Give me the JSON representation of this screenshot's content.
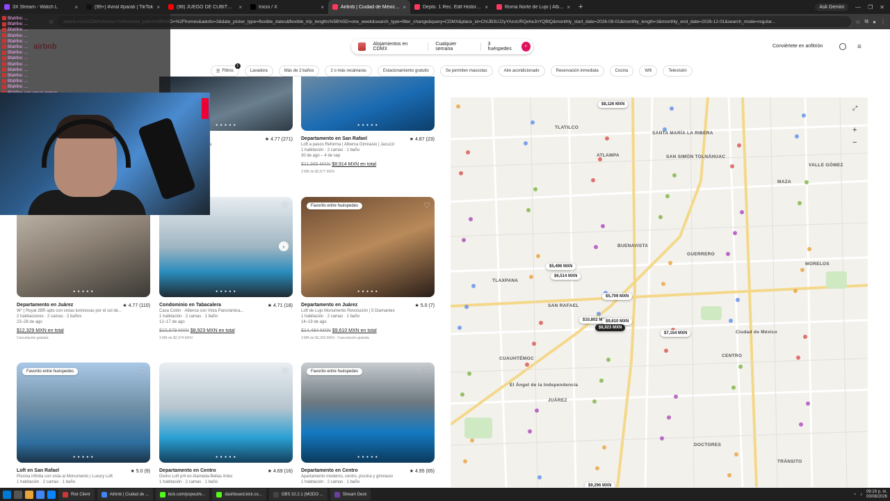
{
  "browser": {
    "tabs": [
      {
        "label": "3X Stream - Watch L",
        "color": "#9146ff"
      },
      {
        "label": "(99+) #viral #parati | TikTok",
        "color": "#111111"
      },
      {
        "label": "(98) JUEGO DE CUBITOS + RE",
        "color": "#ff0000"
      },
      {
        "label": "Inicio / X",
        "color": "#000000"
      },
      {
        "label": "Airbnb | Ciudad de México - Al",
        "color": "#ff385c",
        "active": true
      },
      {
        "label": "Depto. 1 Rec. Edif Histórico Sa",
        "color": "#ff385c"
      },
      {
        "label": "Roma Norte de Lujo | Alberca,",
        "color": "#ff385c"
      }
    ],
    "new_tab": "+",
    "ask_gemini": "Ask Gemini",
    "url": "airbnb.mx/s/CDMX/homes?refinement_paths%5B%5D=%2Fhomes&adults=3&date_picker_type=flexible_dates&flexible_trip_lengths%5B%5D=one_week&search_type=filter_change&query=CDMX&place_id=ChIJB3UJ2yYAzoURQeheJnYQBlQ&monthly_start_date=2026-09-01&monthly_length=3&monthly_end_date=2026-12-01&search_mode=regular..."
  },
  "chat": {
    "lines": [
      "Bfahfire: ...",
      "Bfahfire: ...",
      "Bfahfire: ...",
      "Bfahfire: ...",
      "Bfahfire: ...",
      "Bfahfire: ...",
      "Bfahfire: ...",
      "Bfahfire: ...",
      "Bfahfire: ...",
      "Bfahfire: ...",
      "Bfahfire: ...",
      "Bfahfire: ...",
      "Bfahfire: ...",
      "Bfahfire: sen aguas negras"
    ]
  },
  "header": {
    "logo": "airbnb",
    "search": {
      "location": "Alojamientos en CDMX",
      "dates": "Cualquier semana",
      "guests": "3 huéspedes"
    },
    "host_link": "Conviértete en anfitrión"
  },
  "filters": {
    "main": "Filtros",
    "badge": "1",
    "chips": [
      "Lavadora",
      "Más de 2 baños",
      "2 o más recámaras",
      "Estacionamiento gratuito",
      "Se permiten mascotas",
      "Aire acondicionado",
      "Reservación inmediata",
      "Cocina",
      "Wifi",
      "Televisión"
    ]
  },
  "listings": [
    {
      "title": "...uárez",
      "rating": "★ 4.77 (271)",
      "desc1": "...rvlala de Reforma, alberca",
      "desc2": "1 baño",
      "desc3": "",
      "old_price": "",
      "price": "...XN en total",
      "sub": "...cepada",
      "fav": false
    },
    {
      "title": "Departamento en San Rafael",
      "rating": "★ 4.87 (23)",
      "desc1": "Loft a pasos Reforma | Alberca Gimnasio | Jacuzzi",
      "desc2": "1 habitación · 2 camas · 1 baño",
      "desc3": "30 de ago – 4 de sep",
      "old_price": "$11,565 MXN",
      "price": "$8,914 MXN en total",
      "sub": "3 MB de $2,577 MXN",
      "fav": false
    },
    {
      "title": "Departamento en Juárez",
      "rating": "★ 4.77 (110)",
      "desc1": "W° | Royal 2BR apts con vistas luminosas por el sol de...",
      "desc2": "2 habitaciones · 2 camas · 2 baños",
      "desc3": "23–28 de ago",
      "old_price": "",
      "price": "$12,329 MXN en total",
      "sub": "Cancelación gratuita",
      "fav": false
    },
    {
      "title": "Condominio en Tabacalera",
      "rating": "★ 4.71 (18)",
      "desc1": "Casa Colón · Alberca con Vista Panorámica...",
      "desc2": "1 habitación · 2 camas · 1 baño",
      "desc3": "12–17 de ago",
      "old_price": "$10,679 MXN",
      "price": "$8,923 MXN en total",
      "sub": "3 MB de $2,974 MXN",
      "fav": false
    },
    {
      "title": "Departamento en Juárez",
      "rating": "★ 5.0 (7)",
      "desc1": "Loft de Lujo Monumento Revolución | 5 Diamantes",
      "desc2": "1 habitación · 2 camas · 1 baño",
      "desc3": "14–19 de ago",
      "old_price": "$14,494 MXN",
      "price": "$9,610 MXN en total",
      "sub": "3 MB de $3,203 MXN · Cancelación gratuita",
      "fav": true
    },
    {
      "title": "Loft en San Rafael",
      "rating": "★ 5.0 (9)",
      "desc1": "Piscina infinita con vista al Monumento | Luxury Loft",
      "desc2": "1 habitación · 2 camas · 1 baño",
      "desc3": "",
      "old_price": "",
      "price": "",
      "sub": "",
      "fav": true
    },
    {
      "title": "Departamento en Centro",
      "rating": "★ 4.69 (16)",
      "desc1": "Divino Loft p/4 en Alameda-Bellas Artes",
      "desc2": "1 habitación · 2 camas · 1 baño",
      "desc3": "",
      "old_price": "",
      "price": "",
      "sub": "",
      "fav": false
    },
    {
      "title": "Departamento en Centro",
      "rating": "★ 4.95 (65)",
      "desc1": "Apartamento moderno, centro, piscina y gimnasio",
      "desc2": "1 habitación · 2 camas · 1 baño",
      "desc3": "",
      "old_price": "",
      "price": "",
      "sub": "",
      "fav": true
    }
  ],
  "fav_label": "Favorito entre huéspedes",
  "map": {
    "neighborhoods": [
      "TLATILCO",
      "SANTA MARÍA LA RIBERA",
      "ATLAMPA",
      "SAN SIMÓN TOLNÁHUAC",
      "VALLE GÓMEZ",
      "MAZA",
      "BUENAVISTA",
      "GUERRERO",
      "TLAXPANA",
      "SAN RAFAEL",
      "MORELOS",
      "CUAUHTÉMOC",
      "JUÁREZ",
      "CENTRO",
      "DOCTORES",
      "TRÁNSITO",
      "El Ángel de la Independencia",
      "Ciudad de México"
    ],
    "pins": [
      "$8,126 MXN",
      "$5,496 MXN",
      "$6,514 MXN",
      "$5,709 MXN",
      "$10,802 MXN",
      "$9,610 MXN",
      "$8,923 MXN",
      "$7,154 MXN",
      "$9,296 MXN"
    ],
    "selected_pin": "$8,923 MXN"
  },
  "taskbar": {
    "apps": [
      {
        "label": "Riot Client",
        "color": "#d13639"
      },
      {
        "label": "Airbnb | Ciudad de ...",
        "color": "#4285f4"
      },
      {
        "label": "kick.com/popout/e...",
        "color": "#53fc18"
      },
      {
        "label": "dashboard.kick.co...",
        "color": "#53fc18"
      },
      {
        "label": "OBS 32.2.1 (MODO ...",
        "color": "#444444"
      },
      {
        "label": "Stream Deck",
        "color": "#6b3fa0"
      }
    ],
    "time": "09:19 p. m.",
    "date": "03/08/2026"
  }
}
